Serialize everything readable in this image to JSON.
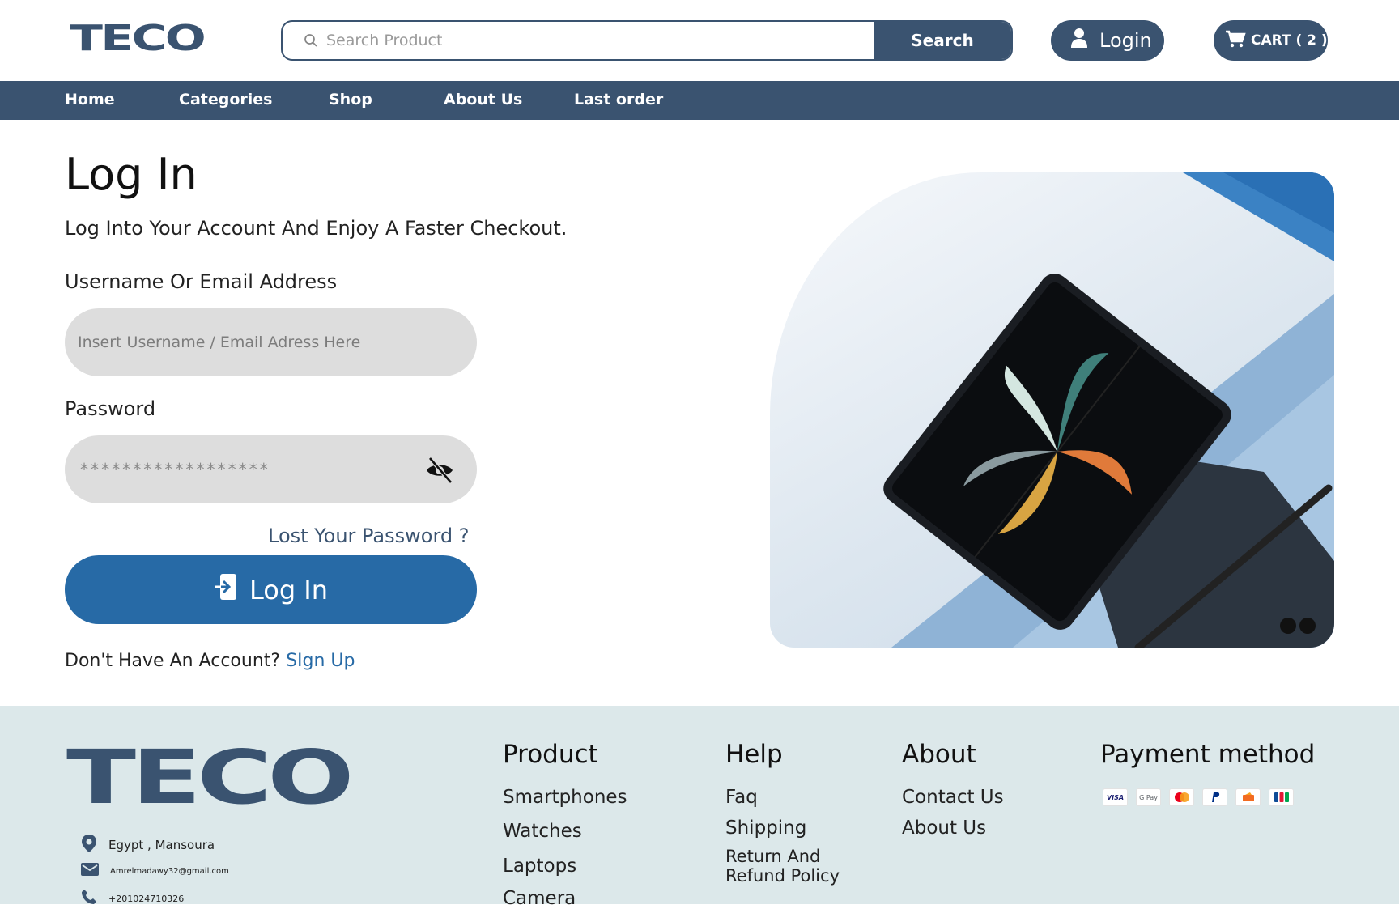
{
  "brand": {
    "name": "TECO"
  },
  "header": {
    "search": {
      "placeholder": "Search Product",
      "button_label": "Search"
    },
    "login_label": "Login",
    "cart_label": "CART ( 2 )"
  },
  "nav": {
    "items": [
      "Home",
      "Categories",
      "Shop",
      "About Us",
      "Last order"
    ]
  },
  "main": {
    "title": "Log In",
    "subtitle": "Log Into Your Account And Enjoy A Faster Checkout.",
    "username_label": "Username Or Email Address",
    "username_placeholder": "Insert Username / Email Adress Here",
    "password_label": "Password",
    "password_mask": "******************",
    "lost_password": "Lost Your Password ?",
    "login_button": "Log In",
    "no_account_text": "Don't Have An Account?",
    "signup_link": "SIgn Up"
  },
  "footer": {
    "address": "Egypt , Mansoura",
    "email": "Amrelmadawy32@gmail.com",
    "phone": "+201024710326",
    "product": {
      "title": "Product",
      "items": [
        "Smartphones",
        "Watches",
        "Laptops",
        "Camera"
      ]
    },
    "help": {
      "title": "Help",
      "items": [
        "Faq",
        "Shipping",
        "Return And",
        "Refund Policy"
      ]
    },
    "about": {
      "title": "About",
      "items": [
        "Contact Us",
        "About Us"
      ]
    },
    "payment": {
      "title": "Payment method",
      "cards": [
        "VISA",
        "G Pay",
        "mastercard",
        "PayPal",
        "card",
        "JCB"
      ]
    }
  },
  "colors": {
    "primary": "#3a5370",
    "accent": "#276aa6",
    "footer_bg": "#dce8ea"
  }
}
